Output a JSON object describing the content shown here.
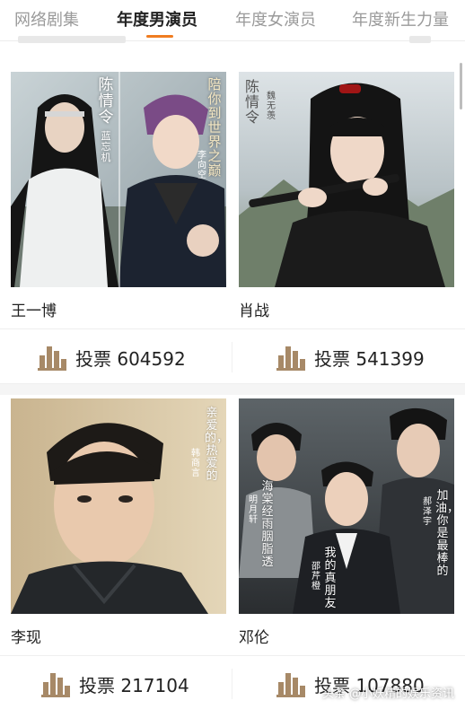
{
  "tabs": [
    {
      "label": "网络剧集",
      "active": false
    },
    {
      "label": "年度男演员",
      "active": true
    },
    {
      "label": "年度女演员",
      "active": false
    },
    {
      "label": "年度新生力量",
      "active": false
    }
  ],
  "accent_color": "#f07c20",
  "bar_icon_color": "#a78967",
  "cards": [
    {
      "name": "王一博",
      "vote_label": "投票 604592",
      "poster_text": {
        "show": "陈情令",
        "role": "蓝忘机",
        "tagline": "陪你到世界之巅",
        "role2": "李向空"
      }
    },
    {
      "name": "肖战",
      "vote_label": "投票 541399",
      "poster_text": {
        "show": "陈情令",
        "role": "魏无羡"
      }
    },
    {
      "name": "李现",
      "vote_label": "投票 217104",
      "poster_text": {
        "line1": "亲爱的，热爱的",
        "role": "韩商言"
      }
    },
    {
      "name": "邓伦",
      "vote_label": "投票 107880",
      "poster_text": {
        "tagline1": "海棠经雨胭脂透",
        "role1": "明月轩",
        "tagline2": "我的真朋友",
        "role2": "邵芹橙",
        "tagline3": "加油，你是最棒的",
        "role3": "郝泽宇"
      }
    }
  ],
  "watermark": "头条 @小妖精的娱乐资讯"
}
